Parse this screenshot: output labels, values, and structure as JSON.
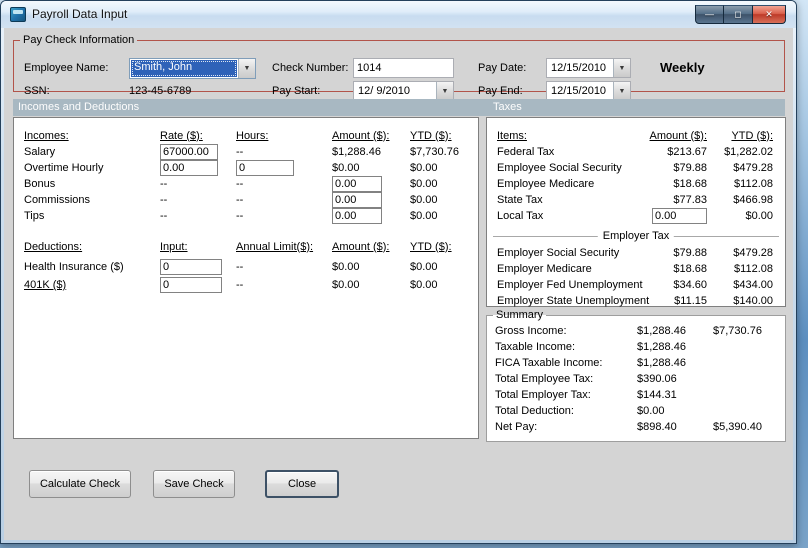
{
  "colors": {
    "accent-red": "#b2544a",
    "band": "#a8b8c2",
    "select-blue": "#2e62b8"
  },
  "icons": {
    "app": "payroll-app-icon",
    "minimize": "—",
    "maximize": "◻",
    "close": "✕",
    "dropdown": "▼"
  },
  "window": {
    "title": "Payroll Data Input"
  },
  "paycheck": {
    "group_label": "Pay Check Information",
    "employee_name_label": "Employee Name:",
    "employee_name_value": "Smith, John",
    "ssn_label": "SSN:",
    "ssn_value": "123-45-6789",
    "check_number_label": "Check Number:",
    "check_number_value": "1014",
    "pay_start_label": "Pay Start:",
    "pay_start_value": "12/ 9/2010",
    "pay_date_label": "Pay Date:",
    "pay_date_value": "12/15/2010",
    "pay_end_label": "Pay End:",
    "pay_end_value": "12/15/2010",
    "frequency": "Weekly"
  },
  "bands": {
    "left": "Incomes and Deductions",
    "right": "Taxes"
  },
  "incomes": {
    "headers": {
      "c1": "Incomes:",
      "c2": "Rate ($):",
      "c3": "Hours:",
      "c4": "Amount ($):",
      "c5": "YTD ($):"
    },
    "salary": {
      "label": "Salary",
      "rate": "67000.00",
      "hours": "--",
      "amount": "$1,288.46",
      "ytd": "$7,730.76"
    },
    "overtime": {
      "label": "Overtime Hourly",
      "rate": "0.00",
      "hours": "0",
      "amount": "$0.00",
      "ytd": "$0.00"
    },
    "bonus": {
      "label": "Bonus",
      "rate": "--",
      "hours": "--",
      "amount": "0.00",
      "ytd": "$0.00"
    },
    "commissions": {
      "label": "Commissions",
      "rate": "--",
      "hours": "--",
      "amount": "0.00",
      "ytd": "$0.00"
    },
    "tips": {
      "label": "Tips",
      "rate": "--",
      "hours": "--",
      "amount": "0.00",
      "ytd": "$0.00"
    }
  },
  "deductions": {
    "headers": {
      "c1": "Deductions:",
      "c2": "Input:",
      "c3": "Annual Limit($):",
      "c4": "Amount ($):",
      "c5": "YTD ($):"
    },
    "health": {
      "label": "Health Insurance  ($)",
      "input": "0",
      "limit": "--",
      "amount": "$0.00",
      "ytd": "$0.00"
    },
    "k401": {
      "label": "401K  ($)",
      "input": "0",
      "limit": "--",
      "amount": "$0.00",
      "ytd": "$0.00"
    }
  },
  "taxes": {
    "headers": {
      "c1": "Items:",
      "c2": "Amount ($):",
      "c3": "YTD ($):"
    },
    "rows": [
      {
        "label": "Federal Tax",
        "amount": "$213.67",
        "ytd": "$1,282.02"
      },
      {
        "label": "Employee Social Security",
        "amount": "$79.88",
        "ytd": "$479.28"
      },
      {
        "label": "Employee Medicare",
        "amount": "$18.68",
        "ytd": "$112.08"
      },
      {
        "label": "State Tax",
        "amount": "$77.83",
        "ytd": "$466.98"
      }
    ],
    "local": {
      "label": "Local Tax",
      "amount": "0.00",
      "ytd": "$0.00"
    },
    "employer_header": "Employer Tax",
    "employer_rows": [
      {
        "label": "Employer Social Security",
        "amount": "$79.88",
        "ytd": "$479.28"
      },
      {
        "label": "Employer Medicare",
        "amount": "$18.68",
        "ytd": "$112.08"
      },
      {
        "label": "Employer Fed Unemployment",
        "amount": "$34.60",
        "ytd": "$434.00"
      },
      {
        "label": "Employer State Unemployment",
        "amount": "$11.15",
        "ytd": "$140.00"
      }
    ]
  },
  "summary": {
    "group_label": "Summary",
    "rows": [
      {
        "label": "Gross Income:",
        "amount": "$1,288.46",
        "ytd": "$7,730.76"
      },
      {
        "label": "Taxable Income:",
        "amount": "$1,288.46",
        "ytd": ""
      },
      {
        "label": "FICA Taxable Income:",
        "amount": "$1,288.46",
        "ytd": ""
      },
      {
        "label": "Total Employee Tax:",
        "amount": "$390.06",
        "ytd": ""
      },
      {
        "label": "Total Employer Tax:",
        "amount": "$144.31",
        "ytd": ""
      },
      {
        "label": "Total Deduction:",
        "amount": "$0.00",
        "ytd": ""
      },
      {
        "label": "Net Pay:",
        "amount": "$898.40",
        "ytd": "$5,390.40"
      }
    ]
  },
  "buttons": {
    "calculate": "Calculate Check",
    "save": "Save Check",
    "close": "Close"
  }
}
